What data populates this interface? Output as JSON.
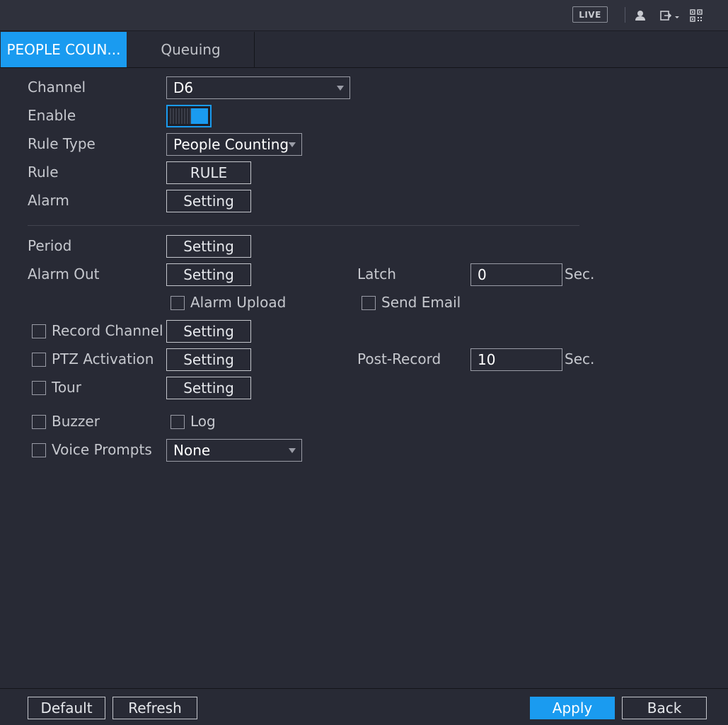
{
  "topbar": {
    "live_label": "LIVE",
    "icons": [
      "user-icon",
      "logout-icon",
      "qr-code-icon"
    ]
  },
  "tabs": [
    {
      "label": "PEOPLE COUN...",
      "active": true
    },
    {
      "label": "Queuing",
      "active": false
    }
  ],
  "form": {
    "channel": {
      "label": "Channel",
      "value": "D6"
    },
    "enable": {
      "label": "Enable",
      "on": true
    },
    "rule_type": {
      "label": "Rule Type",
      "value": "People Counting"
    },
    "rule": {
      "label": "Rule",
      "button": "RULE"
    },
    "alarm": {
      "label": "Alarm",
      "button": "Setting"
    },
    "period": {
      "label": "Period",
      "button": "Setting"
    },
    "alarm_out": {
      "label": "Alarm Out",
      "button": "Setting"
    },
    "latch": {
      "label": "Latch",
      "value": "0",
      "unit": "Sec."
    },
    "alarm_upload": {
      "label": "Alarm Upload",
      "checked": false
    },
    "send_email": {
      "label": "Send Email",
      "checked": false
    },
    "record_channel": {
      "label": "Record Channel",
      "checked": false,
      "button": "Setting"
    },
    "ptz_activation": {
      "label": "PTZ Activation",
      "checked": false,
      "button": "Setting"
    },
    "post_record": {
      "label": "Post-Record",
      "value": "10",
      "unit": "Sec."
    },
    "tour": {
      "label": "Tour",
      "checked": false,
      "button": "Setting"
    },
    "buzzer": {
      "label": "Buzzer",
      "checked": false
    },
    "log": {
      "label": "Log",
      "checked": false
    },
    "voice_prompts": {
      "label": "Voice Prompts",
      "checked": false,
      "value": "None"
    }
  },
  "footer": {
    "default_label": "Default",
    "refresh_label": "Refresh",
    "apply_label": "Apply",
    "back_label": "Back"
  },
  "colors": {
    "accent": "#1a9bf0",
    "background": "#282a35"
  }
}
